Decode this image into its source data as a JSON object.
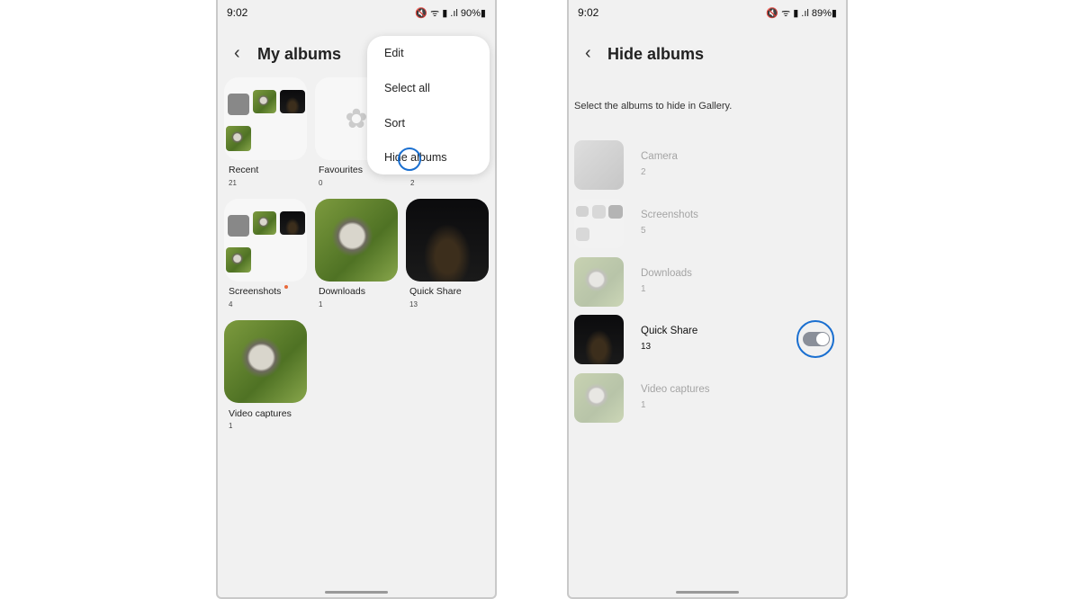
{
  "left": {
    "status": {
      "time": "9:02",
      "icons": "🔇 ᯤ ▮ .ıl 90%▮"
    },
    "title": "My albums",
    "menu": [
      "Edit",
      "Select all",
      "Sort",
      "Hide albums"
    ],
    "albums": [
      {
        "name": "Recent",
        "count": "21"
      },
      {
        "name": "Favourites",
        "count": "0"
      },
      {
        "name": "",
        "count": "2"
      },
      {
        "name": "Screenshots",
        "count": "4"
      },
      {
        "name": "Downloads",
        "count": "1"
      },
      {
        "name": "Quick Share",
        "count": "13"
      },
      {
        "name": "Video captures",
        "count": "1"
      }
    ]
  },
  "right": {
    "status": {
      "time": "9:02",
      "icons": "🔇 ᯤ ▮ .ıl 89%▮"
    },
    "title": "Hide albums",
    "description": "Select the albums to hide in Gallery.",
    "albums": [
      {
        "name": "Camera",
        "count": "2",
        "hidden": false
      },
      {
        "name": "Screenshots",
        "count": "5",
        "hidden": false
      },
      {
        "name": "Downloads",
        "count": "1",
        "hidden": false
      },
      {
        "name": "Quick Share",
        "count": "13",
        "hidden": true
      },
      {
        "name": "Video captures",
        "count": "1",
        "hidden": false
      }
    ]
  },
  "colors": {
    "highlight": "#1a6fd0",
    "toggle": "#8a8f99"
  }
}
